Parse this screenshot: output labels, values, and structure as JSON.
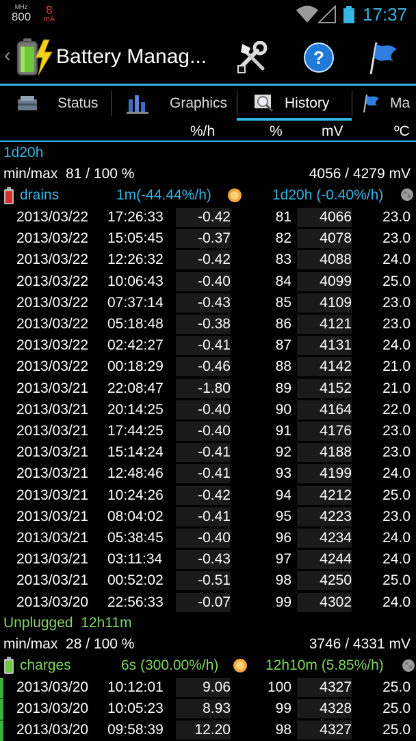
{
  "status_bar": {
    "cpu_unit": "MHz",
    "cpu_value": "800",
    "current_value": "8",
    "current_unit": "mA",
    "time": "17:37",
    "icons": [
      "wifi-icon",
      "signal-icon",
      "battery-icon"
    ]
  },
  "action_bar": {
    "title": "Battery Manag...",
    "icons": [
      "battery-app-icon",
      "tools-icon",
      "help-icon",
      "flag-icon"
    ]
  },
  "tabs": [
    {
      "label": "Status",
      "icon": "toolbox-icon"
    },
    {
      "label": "Graphics",
      "icon": "chart-icon"
    },
    {
      "label": "History",
      "icon": "magnifier-icon",
      "active": true
    },
    {
      "label": "Ma",
      "icon": "flag-icon"
    }
  ],
  "columns": {
    "drain_rate": "%/h",
    "percent": "%",
    "voltage": "mV",
    "temp": "ºC"
  },
  "period": "1d20h",
  "section1": {
    "minmax_label": "min/max",
    "percent_range": "81 / 100 %",
    "voltage_range": "4056 / 4279 mV",
    "type_label": "drains",
    "short_rate": "1m(-44.44%/h)",
    "long_rate": "1d20h (-0.40%/h)",
    "rows": [
      [
        "2013/03/22",
        "17:26:33",
        "-0.42",
        "81",
        "4066",
        "23.0"
      ],
      [
        "2013/03/22",
        "15:05:45",
        "-0.37",
        "82",
        "4078",
        "23.0"
      ],
      [
        "2013/03/22",
        "12:26:32",
        "-0.42",
        "83",
        "4088",
        "24.0"
      ],
      [
        "2013/03/22",
        "10:06:43",
        "-0.40",
        "84",
        "4099",
        "25.0"
      ],
      [
        "2013/03/22",
        "07:37:14",
        "-0.43",
        "85",
        "4109",
        "23.0"
      ],
      [
        "2013/03/22",
        "05:18:48",
        "-0.38",
        "86",
        "4121",
        "23.0"
      ],
      [
        "2013/03/22",
        "02:42:27",
        "-0.41",
        "87",
        "4131",
        "24.0"
      ],
      [
        "2013/03/22",
        "00:18:29",
        "-0.46",
        "88",
        "4142",
        "21.0"
      ],
      [
        "2013/03/21",
        "22:08:47",
        "-1.80",
        "89",
        "4152",
        "21.0"
      ],
      [
        "2013/03/21",
        "20:14:25",
        "-0.40",
        "90",
        "4164",
        "22.0"
      ],
      [
        "2013/03/21",
        "17:44:25",
        "-0.40",
        "91",
        "4176",
        "23.0"
      ],
      [
        "2013/03/21",
        "15:14:24",
        "-0.41",
        "92",
        "4188",
        "23.0"
      ],
      [
        "2013/03/21",
        "12:48:46",
        "-0.41",
        "93",
        "4199",
        "24.0"
      ],
      [
        "2013/03/21",
        "10:24:26",
        "-0.42",
        "94",
        "4212",
        "25.0"
      ],
      [
        "2013/03/21",
        "08:04:02",
        "-0.41",
        "95",
        "4223",
        "23.0"
      ],
      [
        "2013/03/21",
        "05:38:45",
        "-0.40",
        "96",
        "4234",
        "24.0"
      ],
      [
        "2013/03/21",
        "03:11:34",
        "-0.43",
        "97",
        "4244",
        "24.0"
      ],
      [
        "2013/03/21",
        "00:52:02",
        "-0.51",
        "98",
        "4250",
        "25.0"
      ],
      [
        "2013/03/20",
        "22:56:33",
        "-0.07",
        "99",
        "4302",
        "24.0"
      ]
    ]
  },
  "section2": {
    "state_label": "Unplugged",
    "state_duration": "12h11m",
    "minmax_label": "min/max",
    "percent_range": "28 / 100 %",
    "voltage_range": "3746 / 4331 mV",
    "type_label": "charges",
    "short_rate": "6s (300.00%/h)",
    "long_rate": "12h10m (5.85%/h)",
    "rows": [
      [
        "2013/03/20",
        "10:12:01",
        "9.06",
        "100",
        "4327",
        "25.0"
      ],
      [
        "2013/03/20",
        "10:05:23",
        "8.93",
        "99",
        "4328",
        "25.0"
      ],
      [
        "2013/03/20",
        "09:58:39",
        "12.20",
        "98",
        "4327",
        "25.0"
      ]
    ]
  },
  "colors": {
    "accent": "#33b5e5",
    "green": "#7fd65c",
    "red": "#e23b3b"
  }
}
